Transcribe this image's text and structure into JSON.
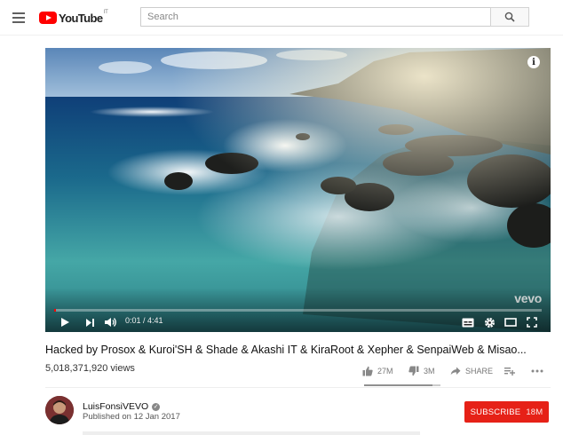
{
  "masthead": {
    "logo_text": "YouTube",
    "logo_region": "IT",
    "search_placeholder": "Search"
  },
  "icons": {
    "menu": "hamburger-menu-icon",
    "search": "search-icon",
    "info": "info-icon",
    "play": "play-icon",
    "next": "skip-next-icon",
    "volume": "volume-icon",
    "captions": "captions-icon",
    "settings": "gear-icon",
    "theater": "theater-mode-icon",
    "fullscreen": "fullscreen-icon",
    "like": "thumbs-up-icon",
    "dislike": "thumbs-down-icon",
    "share": "share-icon",
    "add": "add-to-playlist-icon",
    "more": "more-icon",
    "verified": "verified-check-icon"
  },
  "player": {
    "watermark": "vevo",
    "time": "0:01 / 4:41",
    "progress": 0.004
  },
  "video": {
    "title": "Hacked by Prosox & Kuroi'SH & Shade & Akashi IT & KiraRoot & Xepher & SenpaiWeb & Misao...",
    "views": "5,018,371,920 views",
    "likes": "27M",
    "dislikes": "3M",
    "share_label": "SHARE",
    "like_ratio": 0.9
  },
  "channel": {
    "name": "LuisFonsiVEVO",
    "published": "Published on 12 Jan 2017",
    "subscribe_label": "SUBSCRIBE",
    "subscriber_count": "18M"
  },
  "colors": {
    "brand_red": "#ff0000",
    "subscribe_red": "#e62117"
  }
}
